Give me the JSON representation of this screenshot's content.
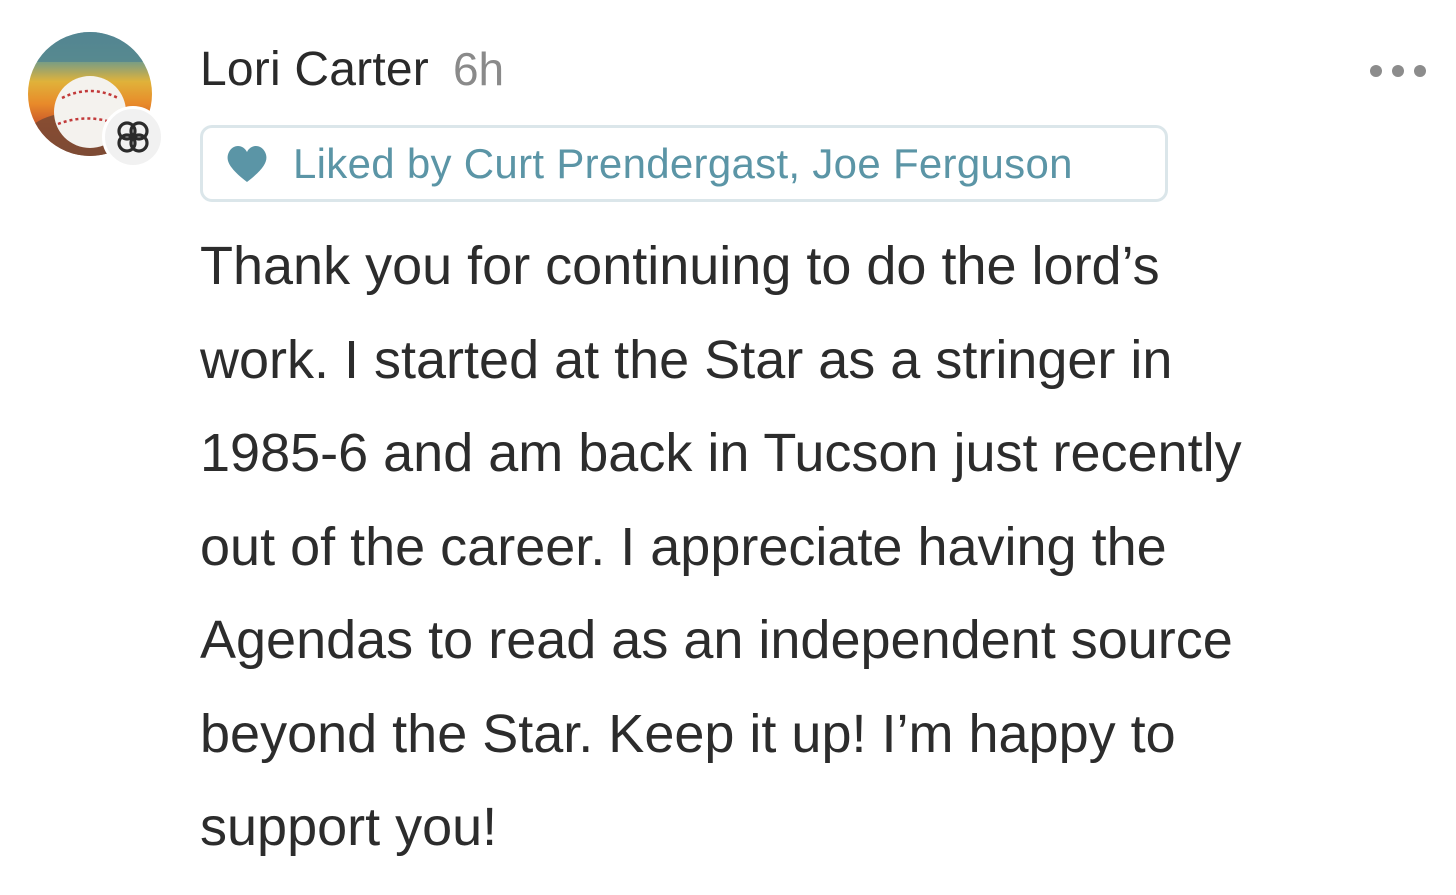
{
  "comment": {
    "author": "Lori Carter",
    "timestamp": "6h",
    "liked_by": "Liked by Curt Prendergast, Joe Ferguson",
    "text": "Thank you for continuing to do the lord’s\nwork. I started at the Star as a stringer in\n1985-6 and am back in Tucson just recently\nout of the career. I appreciate having the\nAgendas to read as an independent source\nbeyond the Star. Keep it up! I’m happy to\nsupport you!",
    "avatar_icon": "baseball-photo",
    "badge_icon": "subscriber-badge-icon",
    "menu_icon": "more-options-icon"
  },
  "colors": {
    "like_accent": "#5b95a6",
    "like_border": "#dbe6ea",
    "timestamp": "#8a8a8a",
    "text": "#2c2c2c"
  }
}
